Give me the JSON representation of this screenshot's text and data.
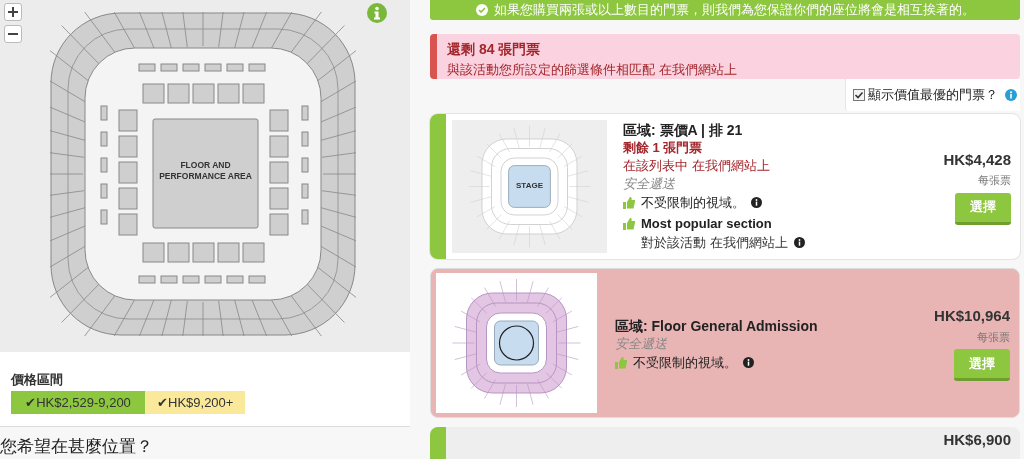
{
  "map": {
    "floor_label": "FLOOR AND PERFORMANCE AREA"
  },
  "price_ranges": {
    "title": "價格區間",
    "items": [
      {
        "label": "✔HK$2,529-9,200",
        "color": "#8dc63f"
      },
      {
        "label": "✔HK$9,200+",
        "color": "#fbe99b"
      }
    ]
  },
  "question": "您希望在甚麼位置？",
  "notice": "如果您購買兩張或以上數目的門票，則我們為您保證你們的座位將會是相互挨著的。",
  "alert": {
    "title": "還剩 84 張門票",
    "text": "與該活動您所設定的篩選條件相匹配 在我們網站上"
  },
  "best_value": {
    "label": "顯示價值最優的門票？",
    "checked": true
  },
  "listings": [
    {
      "selected": false,
      "thumb_label": "STAGE",
      "section": "區域: 票價A | 排 21",
      "remaining": "剩餘 1 張門票",
      "note": "在該列表中 在我們網站上",
      "delivery": "安全遞送",
      "features": [
        {
          "title": "不受限制的視域。"
        },
        {
          "title": "Most popular section",
          "subtitle": "對於該活動 在我們網站上"
        }
      ],
      "price": "HK$4,428",
      "per": "每張票",
      "button": "選擇"
    },
    {
      "selected": true,
      "section": "區域: Floor General Admission",
      "delivery": "安全遞送",
      "features": [
        {
          "title": "不受限制的視域。"
        }
      ],
      "price": "HK$10,964",
      "per": "每張票",
      "button": "選擇"
    },
    {
      "selected": false,
      "price": "HK$6,900"
    }
  ]
}
